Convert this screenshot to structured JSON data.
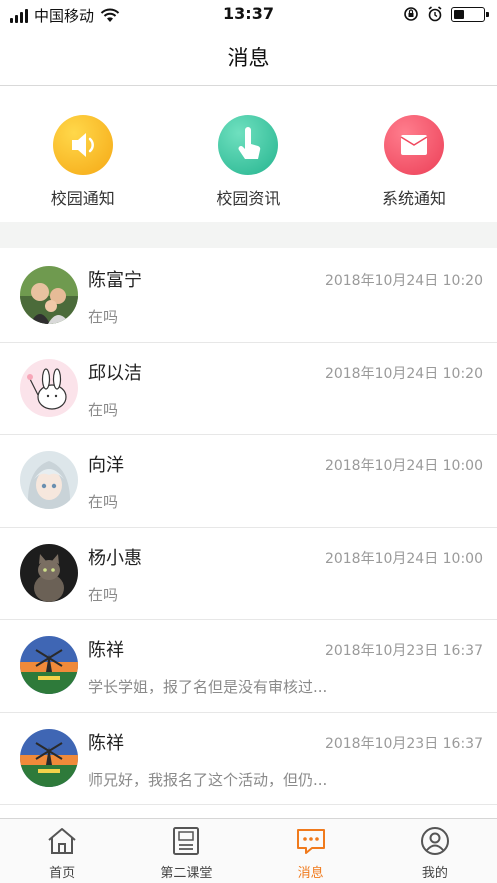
{
  "status_bar": {
    "carrier": "中国移动",
    "time": "13:37"
  },
  "nav": {
    "title": "消息"
  },
  "categories": [
    {
      "label": "校园通知",
      "icon": "speaker-icon",
      "color": "#f9b21e"
    },
    {
      "label": "校园资讯",
      "icon": "tap-hand-icon",
      "color": "#2fc0a0"
    },
    {
      "label": "系统通知",
      "icon": "envelope-icon",
      "color": "#f0485e"
    }
  ],
  "messages": [
    {
      "name": "陈富宁",
      "time": "2018年10月24日 10:20",
      "preview": "在吗"
    },
    {
      "name": "邱以洁",
      "time": "2018年10月24日 10:20",
      "preview": "在吗"
    },
    {
      "name": "向洋",
      "time": "2018年10月24日 10:00",
      "preview": "在吗"
    },
    {
      "name": "杨小惠",
      "time": "2018年10月24日 10:00",
      "preview": "在吗"
    },
    {
      "name": "陈祥",
      "time": "2018年10月23日 16:37",
      "preview": "学长学姐，报了名但是没有审核过..."
    },
    {
      "name": "陈祥",
      "time": "2018年10月23日 16:37",
      "preview": "师兄好，我报名了这个活动，但仍..."
    }
  ],
  "tabs": [
    {
      "label": "首页",
      "icon": "home-icon",
      "active": false
    },
    {
      "label": "第二课堂",
      "icon": "classroom-icon",
      "active": false
    },
    {
      "label": "消息",
      "icon": "message-icon",
      "active": true
    },
    {
      "label": "我的",
      "icon": "profile-icon",
      "active": false
    }
  ],
  "colors": {
    "accent": "#f07a1c",
    "inactive_tab": "#555555"
  }
}
